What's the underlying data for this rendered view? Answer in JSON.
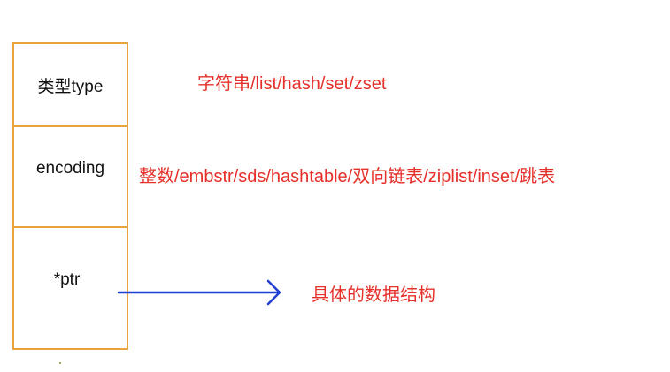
{
  "struct": {
    "fields": [
      {
        "label": "类型type"
      },
      {
        "label": "encoding"
      },
      {
        "label": "*ptr"
      }
    ]
  },
  "descriptions": {
    "type": "字符串/list/hash/set/zset",
    "encoding": "整数/embstr/sds/hashtable/双向链表/ziplist/inset/跳表",
    "ptr": "具体的数据结构"
  },
  "colors": {
    "box_border": "#e8a33c",
    "description_text": "#e6302a",
    "arrow": "#1f3fcf"
  }
}
